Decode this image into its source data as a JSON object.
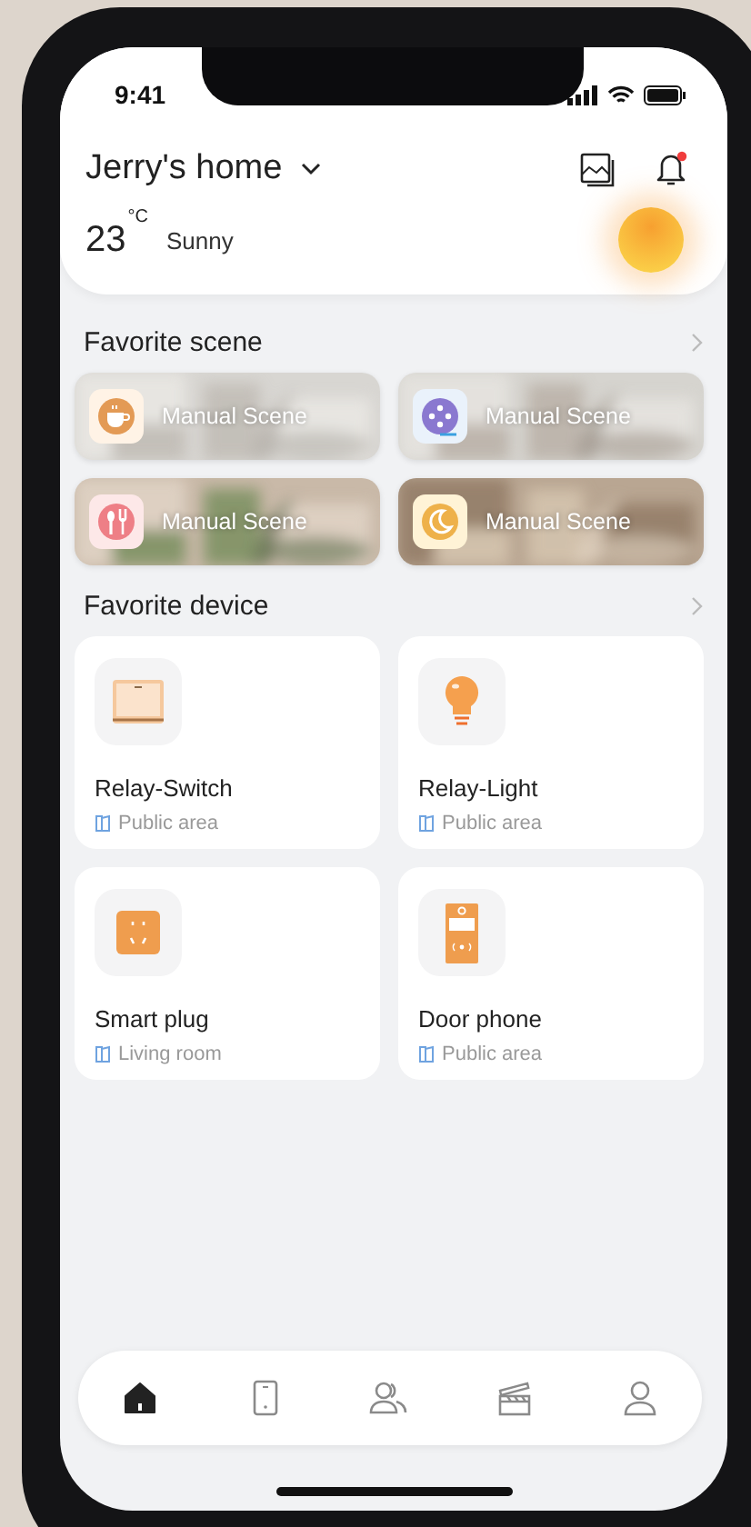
{
  "status_bar": {
    "time": "9:41"
  },
  "header": {
    "home_name": "Jerry's home",
    "has_unread": true,
    "temperature": "23",
    "unit": "°C",
    "condition": "Sunny"
  },
  "favorite_scene": {
    "title": "Favorite scene",
    "items": [
      {
        "kind": "coffee",
        "label": "Manual Scene"
      },
      {
        "kind": "film",
        "label": "Manual Scene"
      },
      {
        "kind": "dining",
        "label": "Manual Scene"
      },
      {
        "kind": "moon",
        "label": "Manual Scene"
      }
    ]
  },
  "favorite_device": {
    "title": "Favorite device",
    "items": [
      {
        "kind": "switch",
        "name": "Relay-Switch",
        "room": "Public area"
      },
      {
        "kind": "bulb",
        "name": "Relay-Light",
        "room": "Public area"
      },
      {
        "kind": "plug",
        "name": "Smart plug",
        "room": "Living room"
      },
      {
        "kind": "doorphone",
        "name": "Door phone",
        "room": "Public area"
      }
    ]
  },
  "tab_bar": [
    {
      "kind": "home",
      "selected": true
    },
    {
      "kind": "device",
      "selected": false
    },
    {
      "kind": "members",
      "selected": false
    },
    {
      "kind": "scene",
      "selected": false
    },
    {
      "kind": "profile",
      "selected": false
    }
  ]
}
